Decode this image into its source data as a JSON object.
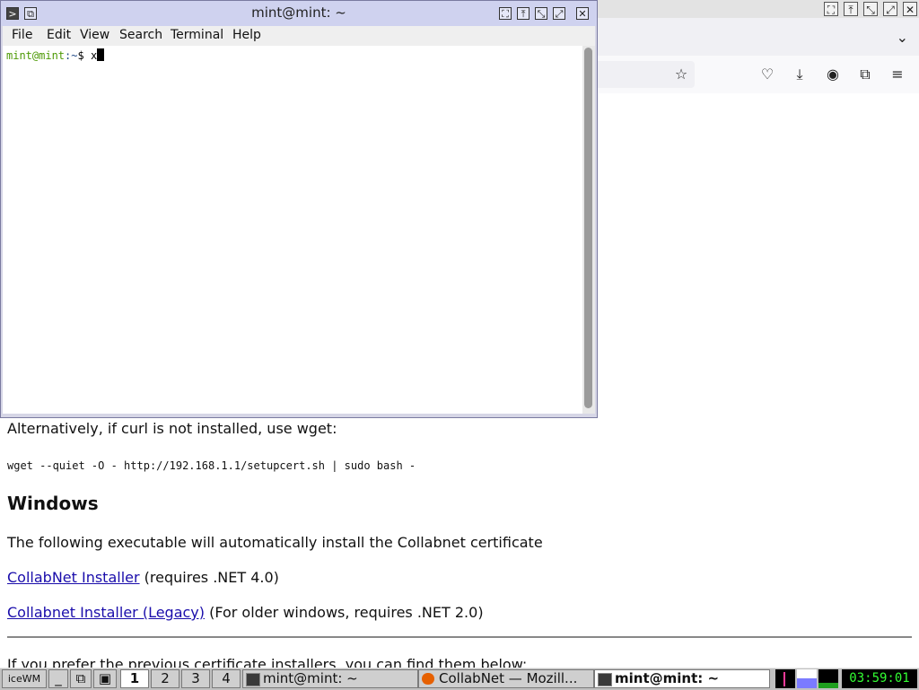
{
  "browser": {
    "window_buttons": [
      "maximize",
      "raise",
      "shade",
      "close"
    ],
    "toolbar_icons": [
      "star-icon",
      "pocket-icon",
      "download-icon",
      "account-icon",
      "extensions-icon",
      "menu-icon"
    ],
    "page": {
      "alt_text": "Alternatively, if curl is not installed, use wget:",
      "wget_command": "wget --quiet -O - http://192.168.1.1/setupcert.sh | sudo bash -",
      "windows_heading": "Windows",
      "windows_desc": "The following executable will automatically install the Collabnet certificate",
      "installer_link": "CollabNet Installer",
      "installer_note": " (requires .NET 4.0)",
      "legacy_link": "Collabnet Installer (Legacy)",
      "legacy_note": " (For older windows, requires .NET 2.0)",
      "previous_text": "If you prefer the previous certificate installers, you can find them below:"
    }
  },
  "terminal": {
    "title": "mint@mint: ~",
    "menu": [
      "File",
      "Edit",
      "View",
      "Search",
      "Terminal",
      "Help"
    ],
    "prompt_user": "mint@mint",
    "prompt_path": ":~",
    "prompt_symbol": "$ ",
    "input": "x"
  },
  "taskbar": {
    "workspaces": [
      "1",
      "2",
      "3",
      "4"
    ],
    "active_workspace": "1",
    "tasks": [
      {
        "label": "mint@mint: ~",
        "icon": "terminal-icon"
      },
      {
        "label": "CollabNet — Mozill...",
        "icon": "firefox-icon"
      },
      {
        "label": "mint@mint: ~",
        "icon": "terminal-icon",
        "active": true
      }
    ],
    "clock": "03:59:01"
  },
  "colors": {
    "link": "#1a0dab",
    "prompt_user": "#4e9a06",
    "prompt_path": "#204a87",
    "clock_text": "#33ff33"
  }
}
